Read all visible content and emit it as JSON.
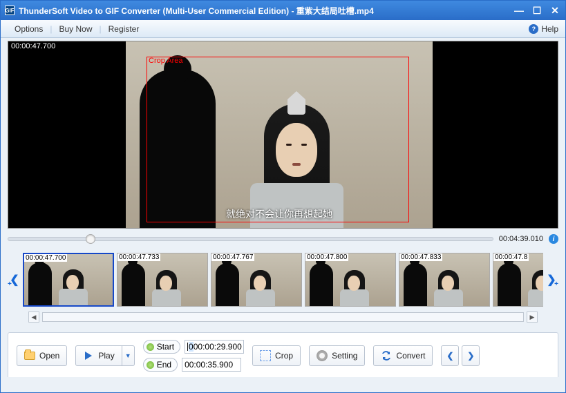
{
  "title": "ThunderSoft Video to GIF Converter (Multi-User Commercial Edition) - 重紫大结局吐槽.mp4",
  "menu": {
    "options": "Options",
    "buy": "Buy Now",
    "register": "Register",
    "help": "Help"
  },
  "video": {
    "currentTs": "00:00:47.700",
    "duration": "00:04:39.010",
    "subtitle": "就绝对不会让你再想起她",
    "cropLabel": "Crop Area"
  },
  "thumbs": [
    {
      "ts": "00:00:47.700",
      "selected": true
    },
    {
      "ts": "00:00:47.733",
      "selected": false
    },
    {
      "ts": "00:00:47.767",
      "selected": false
    },
    {
      "ts": "00:00:47.800",
      "selected": false
    },
    {
      "ts": "00:00:47.833",
      "selected": false
    },
    {
      "ts": "00:00:47.8",
      "selected": false
    }
  ],
  "buttons": {
    "open": "Open",
    "play": "Play",
    "start": "Start",
    "end": "End",
    "crop": "Crop",
    "setting": "Setting",
    "convert": "Convert"
  },
  "times": {
    "start": "00:00:29.900",
    "startPrefix": "0",
    "end": "00:00:35.900"
  },
  "seekPercent": 17
}
